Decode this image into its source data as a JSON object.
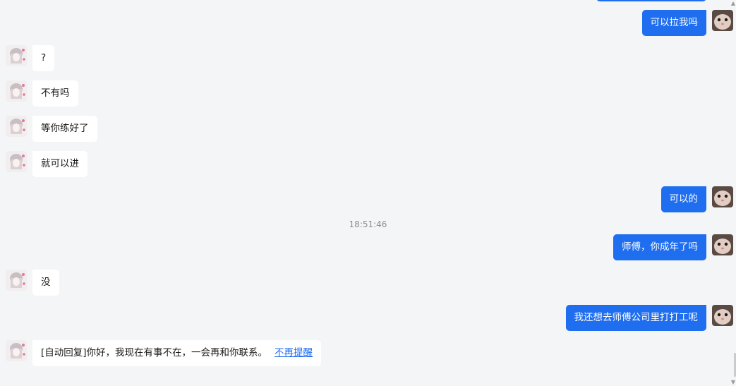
{
  "timestamp": "18:51:46",
  "messages": [
    {
      "side": "out",
      "text": "可以拉我吗"
    },
    {
      "side": "in",
      "text": "?"
    },
    {
      "side": "in",
      "text": "不有吗"
    },
    {
      "side": "in",
      "text": "等你练好了"
    },
    {
      "side": "in",
      "text": "就可以进"
    },
    {
      "side": "out",
      "text": "可以的"
    },
    {
      "side": "out",
      "text": "师傅，你成年了吗"
    },
    {
      "side": "in",
      "text": "没"
    },
    {
      "side": "out",
      "text": "我还想去师傅公司里打打工呢"
    },
    {
      "side": "in",
      "text": "[自动回复]你好，我现在有事不在，一会再和你联系。",
      "link": "不再提醒"
    }
  ],
  "icons": {
    "contact_avatar": "anime-girl-avatar-icon",
    "self_avatar": "cat-avatar-icon",
    "scroll_up": "▲",
    "scroll_down": "▼"
  },
  "colors": {
    "background": "#f4f5f7",
    "outgoing_bubble": "#1f6ef0",
    "incoming_bubble": "#ffffff",
    "link": "#1f6ef0"
  }
}
